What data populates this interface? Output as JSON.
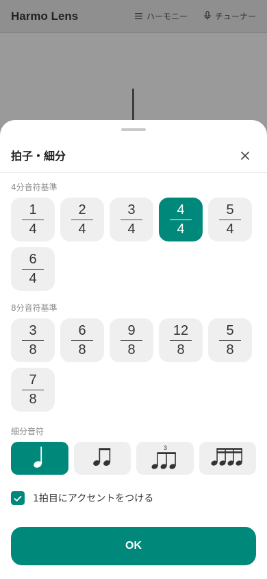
{
  "app": {
    "title": "Harmo Lens",
    "nav": [
      {
        "label": "ハーモニー",
        "icon": "list-icon"
      },
      {
        "label": "チューナー",
        "icon": "mic-icon"
      }
    ]
  },
  "sheet": {
    "title": "拍子・細分",
    "close_icon": "close-icon",
    "quarter_section_label": "4分音符基準",
    "quarter_time_signatures": [
      {
        "top": "1",
        "bottom": "4",
        "selected": false
      },
      {
        "top": "2",
        "bottom": "4",
        "selected": false
      },
      {
        "top": "3",
        "bottom": "4",
        "selected": false
      },
      {
        "top": "4",
        "bottom": "4",
        "selected": true
      },
      {
        "top": "5",
        "bottom": "4",
        "selected": false
      },
      {
        "top": "6",
        "bottom": "4",
        "selected": false
      }
    ],
    "eighth_section_label": "8分音符基準",
    "eighth_time_signatures": [
      {
        "top": "3",
        "bottom": "8",
        "selected": false
      },
      {
        "top": "6",
        "bottom": "8",
        "selected": false
      },
      {
        "top": "9",
        "bottom": "8",
        "selected": false
      },
      {
        "top": "12",
        "bottom": "8",
        "selected": false
      },
      {
        "top": "5",
        "bottom": "8",
        "selected": false
      },
      {
        "top": "7",
        "bottom": "8",
        "selected": false
      }
    ],
    "subdivision_section_label": "細分音符",
    "subdivisions": [
      {
        "icon": "quarter-note-icon",
        "selected": true
      },
      {
        "icon": "eighth-notes-icon",
        "selected": false
      },
      {
        "icon": "triplet-notes-icon",
        "triplet_label": "3",
        "selected": false
      },
      {
        "icon": "sixteenth-notes-icon",
        "selected": false
      }
    ],
    "accent_label": "1拍目にアクセントをつける",
    "accent_checked": true,
    "ok_label": "OK"
  },
  "colors": {
    "accent": "#00897b",
    "button_bg": "#efefef",
    "overlay_bg": "#9a9a9a"
  }
}
